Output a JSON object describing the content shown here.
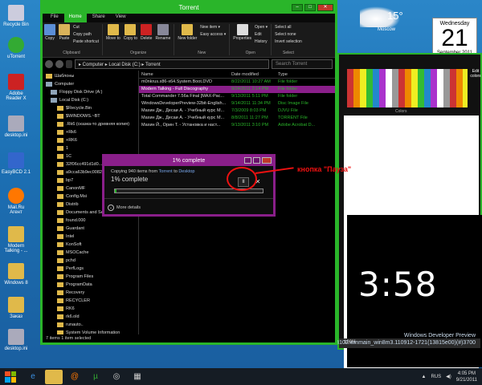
{
  "explorer": {
    "title": "Torrent",
    "tabs": [
      "File",
      "Home",
      "Share",
      "View"
    ],
    "active_tab": "Home",
    "ribbon": {
      "clipboard": {
        "group": "Clipboard",
        "copy": "Copy",
        "paste": "Paste",
        "cut": "Cut",
        "copy_path": "Copy path",
        "paste_shortcut": "Paste shortcut"
      },
      "organize": {
        "group": "Organize",
        "move_to": "Move to",
        "copy_to": "Copy to",
        "delete": "Delete",
        "rename": "Rename"
      },
      "new": {
        "group": "New",
        "new_folder": "New folder",
        "new_item": "New item ▾",
        "easy_access": "Easy access ▾"
      },
      "open": {
        "group": "Open",
        "properties": "Properties",
        "open": "Open ▾",
        "edit": "Edit",
        "history": "History"
      },
      "select": {
        "group": "Select",
        "select_all": "Select all",
        "select_none": "Select none",
        "invert": "Invert selection"
      }
    },
    "address": "▸ Computer ▸ Local Disk (C:) ▸ Torrent",
    "search_placeholder": "Search Torrent",
    "nav_items": [
      "Шаблоны",
      "Computer",
      "Floppy Disk Drive (A:)",
      "Local Disk (C:)",
      "$Recycle.Bin",
      "$WINDOWS.~BT",
      ".Rk6 (сказка-то древняя копия)",
      "+Rk6",
      "+RK6",
      "1",
      "1C",
      "32f06cc491d1d0...",
      "a9cca63b9ec0082e",
      "bp7",
      "CanonMF",
      "Config.Msi",
      "Distrib",
      "Documents and Se...",
      "found.000",
      "Guardant",
      "Intel",
      "KonSoft",
      "MSOCache",
      "pchd",
      "PerfLogs",
      "Program Files",
      "ProgramData",
      "Recovery",
      "RECYCLER",
      "RK6",
      "rk6.old",
      "runauto..",
      "System Volume Information",
      "Temp",
      "Torrent",
      "Users",
      "Virtual Machine..."
    ],
    "selected_nav": "Torrent",
    "columns": [
      "Name",
      "Date modified",
      "Type"
    ],
    "files": [
      {
        "name": "m0nkrus.x86-x64.System.Boot.DVD",
        "date": "8/22/2011 10:27 AM",
        "type": "File folder"
      },
      {
        "name": "Modern Talking - Full Discography",
        "date": "9/24/2011 2:14 PM",
        "type": "File folder"
      },
      {
        "name": "Total Commander 7.56a Final [MAX-Pac...",
        "date": "9/13/2011 5:11 PM",
        "type": "File folder"
      },
      {
        "name": "WindowsDeveloperPreview-32bit-English...",
        "date": "9/14/2011 11:34 PM",
        "type": "Disc Image File"
      },
      {
        "name": "Махин Дж., Десаи А. - Учебный курс M...",
        "date": "7/3/2009 8:03 PM",
        "type": "DJVU File"
      },
      {
        "name": "Махин Дж., Десаи А. - Учебный курс M...",
        "date": "8/8/2011 11:27 PM",
        "type": "TORRENT File"
      },
      {
        "name": "Махин Й., Орин Т. - Установка и наст...",
        "date": "9/13/2011 3:10 PM",
        "type": "Adobe Acrobat D..."
      }
    ],
    "status": "7 items     1 item selected"
  },
  "dialog": {
    "title": "1% complete",
    "copying_prefix": "Copying 940 items from",
    "from": "Torrent",
    "to_word": "to",
    "to": "Desktop",
    "percent_label": "1% complete",
    "progress": 0.01,
    "pause_label": "II",
    "cancel_label": "✕",
    "more_details": "More details"
  },
  "annotation": "кнопка \"Пауза\"",
  "desktop": {
    "icons": [
      "Recycle Bin",
      "uTorrent",
      "Adobe Reader X",
      "desktop.ini",
      "EasyBCD 2.1",
      "Mail.Ru Агент",
      "Modern Talking - ...",
      "Windows 8",
      "Заказ",
      "desktop.ini"
    ]
  },
  "calendar": {
    "dow": "Wednesday",
    "day": "21",
    "month": "September 2011"
  },
  "weather": {
    "temp": "15°",
    "city": "Moscow"
  },
  "big_clock": "3:58",
  "watermark": {
    "line1": "Windows Developer Preview",
    "line2": "8102.winmain_win8m3.110912-1721(13815e00)(#)3700"
  },
  "paint": {
    "edit_colors": "Edit colors",
    "colors": "Colors",
    "zoom": "100%"
  },
  "taskbar": {
    "lang": "RUS",
    "time": "4:05 PM",
    "date": "9/21/2011"
  },
  "colors": {
    "accent_green": "#2ab52a",
    "accent_purple": "#8a1f8a",
    "annotation_red": "#ee1111"
  }
}
